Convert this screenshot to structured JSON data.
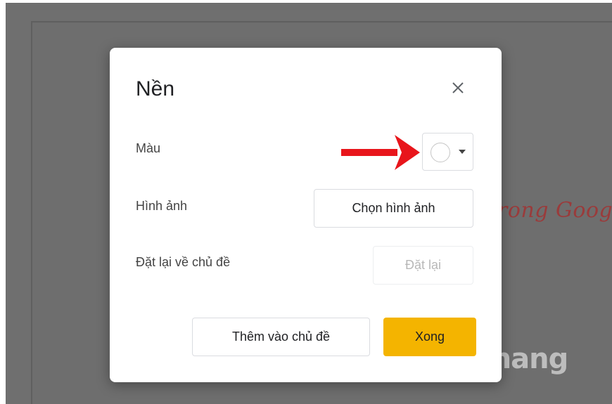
{
  "background": {
    "slide_text": "rong Goog",
    "watermark_text": "uantrimang"
  },
  "dialog": {
    "title": "Nền",
    "color_label": "Màu",
    "image_label": "Hình ảnh",
    "choose_image_button": "Chọn hình ảnh",
    "reset_label": "Đặt lại về chủ đề",
    "reset_button": "Đặt lại",
    "add_to_theme_button": "Thêm vào chủ đề",
    "done_button": "Xong",
    "selected_color": "#ffffff",
    "accent_color": "#f4b400",
    "annotation_arrow_color": "#e8151b"
  }
}
